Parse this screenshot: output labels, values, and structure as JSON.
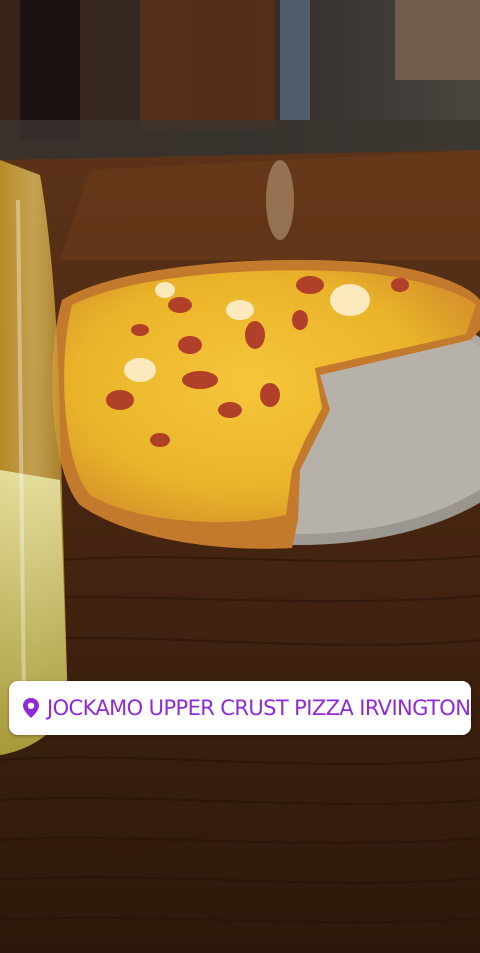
{
  "photo": {
    "subject": "pizza-on-table"
  },
  "sticker": {
    "icon": "location-pin-icon",
    "label": "JOCKAMO UPPER CRUST PIZZA IRVINGTON",
    "accent_color": "#8e2bd6"
  }
}
